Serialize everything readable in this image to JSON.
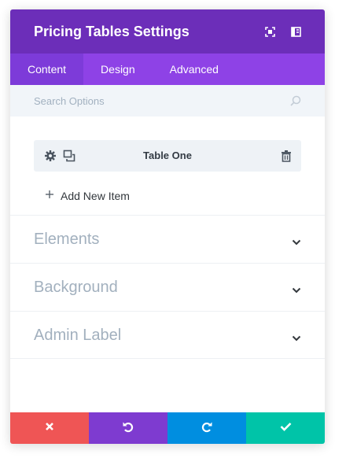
{
  "header": {
    "title": "Pricing Tables Settings",
    "icons": [
      "expand-icon",
      "sidebar-icon"
    ]
  },
  "tabs": [
    {
      "label": "Content",
      "active": true
    },
    {
      "label": "Design",
      "active": false
    },
    {
      "label": "Advanced",
      "active": false
    }
  ],
  "search": {
    "placeholder": "Search Options"
  },
  "items": [
    {
      "label": "Table One",
      "icons": [
        "gear-icon",
        "duplicate-icon",
        "trash-icon"
      ]
    }
  ],
  "add_item": {
    "label": "Add New Item"
  },
  "sections": [
    {
      "label": "Elements"
    },
    {
      "label": "Background"
    },
    {
      "label": "Admin Label"
    }
  ],
  "footer": [
    {
      "name": "cancel",
      "icon": "close-icon",
      "color": "#ef5555"
    },
    {
      "name": "undo",
      "icon": "undo-icon",
      "color": "#7e3bd0"
    },
    {
      "name": "redo",
      "icon": "redo-icon",
      "color": "#008ee0"
    },
    {
      "name": "save",
      "icon": "check-icon",
      "color": "#00c4a8"
    }
  ],
  "colors": {
    "header": "#6c2eb9",
    "tabs": "#8e42e6",
    "active_tab": "#7d3bd9",
    "search_bg": "#f1f5f9"
  }
}
